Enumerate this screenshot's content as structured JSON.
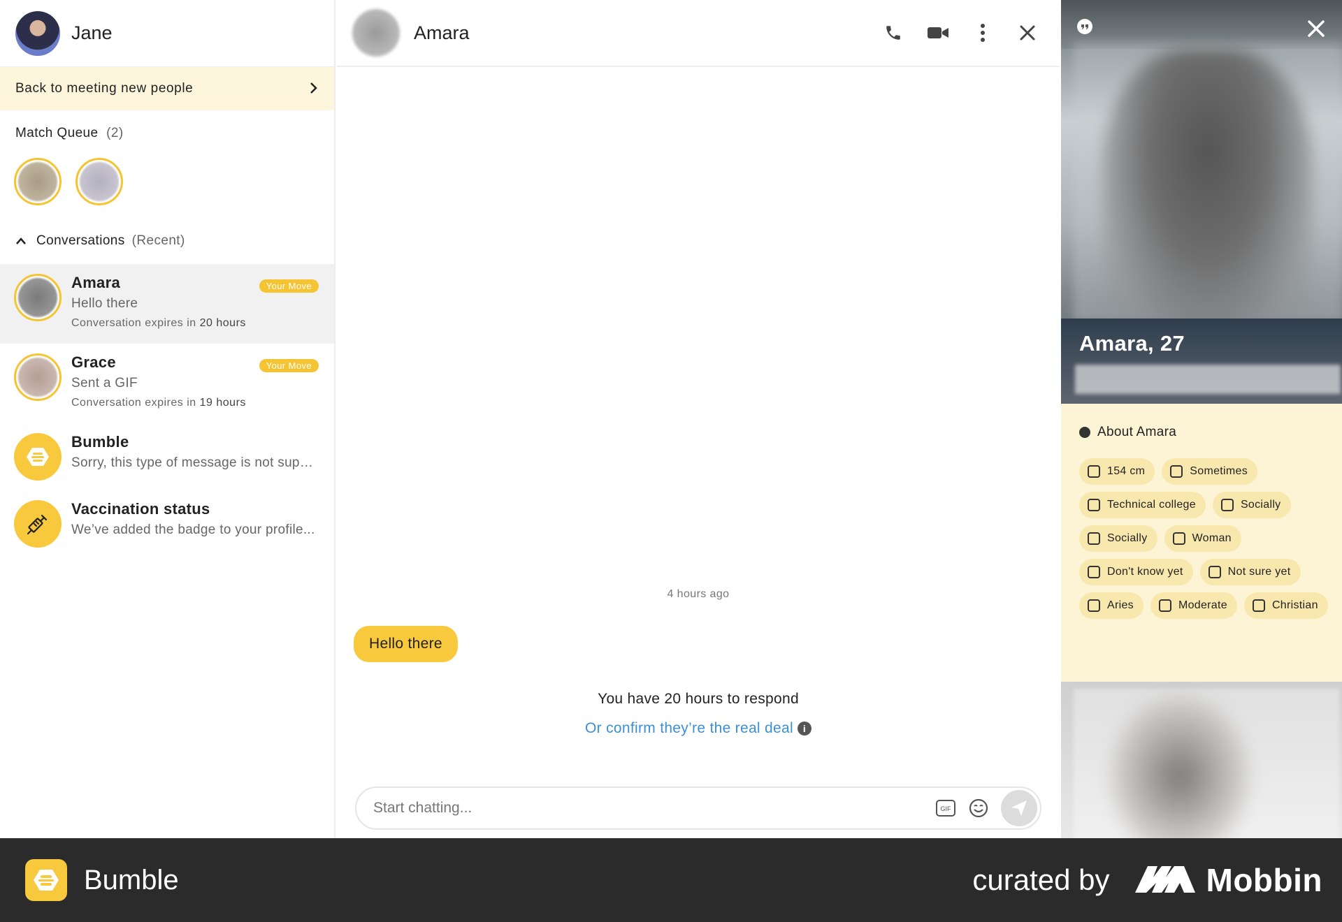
{
  "user": {
    "name": "Jane"
  },
  "sidebar": {
    "back_banner": "Back to meeting new people",
    "match_queue": {
      "title": "Match Queue",
      "count": "(2)"
    },
    "conversations": {
      "title": "Conversations",
      "sub": "(Recent)",
      "items": [
        {
          "name": "Amara",
          "message": "Hello there",
          "expires_prefix": "Conversation expires in ",
          "expires_value": "20 hours",
          "badge": "Your Move"
        },
        {
          "name": "Grace",
          "message": "Sent a GIF",
          "expires_prefix": "Conversation expires in ",
          "expires_value": "19 hours",
          "badge": "Your Move"
        },
        {
          "name": "Bumble",
          "message": "Sorry, this type of message is not supp..."
        },
        {
          "name": "Vaccination status",
          "message": "We’ve added the badge to your profile..."
        }
      ]
    }
  },
  "chat": {
    "name": "Amara",
    "timestamp": "4 hours ago",
    "message": "Hello there",
    "respond_note": "You have 20 hours to respond",
    "confirm_link": "Or confirm they’re the real deal",
    "input_placeholder": "Start chatting..."
  },
  "profile": {
    "name_age": "Amara, 27",
    "about_title": "About Amara",
    "chips": [
      {
        "icon": "ruler-icon",
        "label": "154 cm"
      },
      {
        "icon": "dumbbell-icon",
        "label": "Sometimes"
      },
      {
        "icon": "graduation-cap-icon",
        "label": "Technical college"
      },
      {
        "icon": "glass-icon",
        "label": "Socially"
      },
      {
        "icon": "smoking-icon",
        "label": "Socially"
      },
      {
        "icon": "woman-icon",
        "label": "Woman"
      },
      {
        "icon": "search-icon",
        "label": "Don't know yet"
      },
      {
        "icon": "baby-bottle-icon",
        "label": "Not sure yet"
      },
      {
        "icon": "zodiac-icon",
        "label": "Aries"
      },
      {
        "icon": "government-icon",
        "label": "Moderate"
      },
      {
        "icon": "praying-hands-icon",
        "label": "Christian"
      }
    ]
  },
  "footer": {
    "brand": "Bumble",
    "curated": "curated by",
    "mobbin": "Mobbin"
  },
  "colors": {
    "accent": "#f8c93c",
    "link": "#3d8fd8",
    "banner": "#fdf6dc",
    "panel": "#fdf4d6",
    "footer": "#2b2b2b"
  }
}
